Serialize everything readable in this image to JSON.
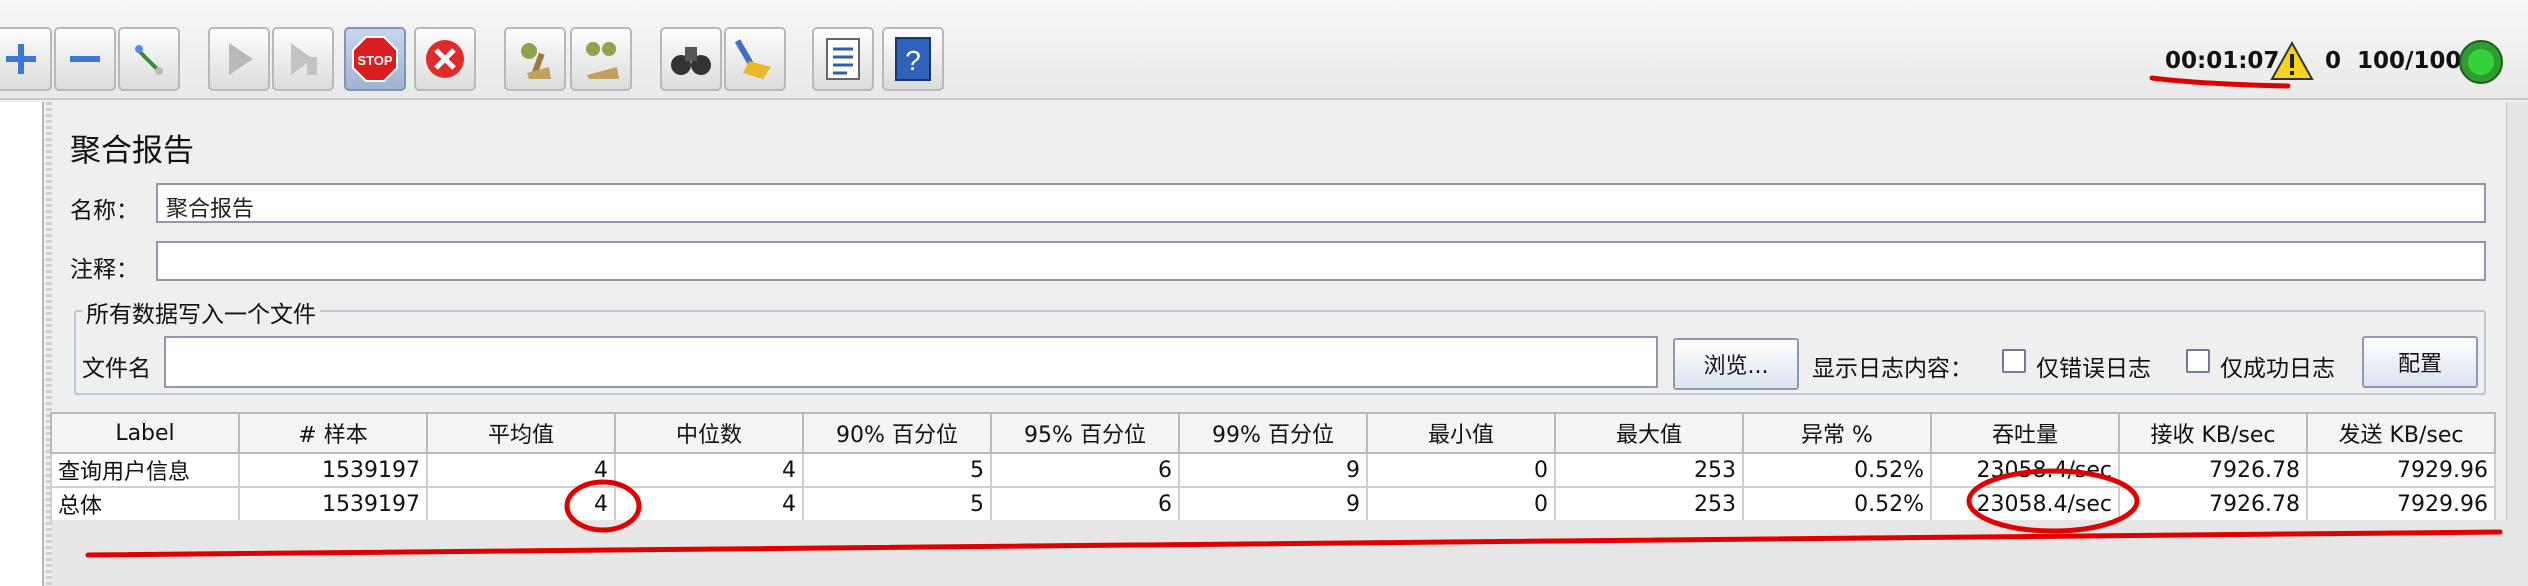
{
  "toolbar": {
    "buttons": [
      "add",
      "remove",
      "toggle",
      "start",
      "start-no-pause",
      "stop",
      "shutdown",
      "clear",
      "clear-all",
      "search",
      "reset-search",
      "function-helper",
      "help"
    ]
  },
  "status": {
    "timer": "00:01:07",
    "error_count": "0",
    "threads": "100/100"
  },
  "panel": {
    "title": "聚合报告",
    "name_label": "名称：",
    "name_value": "聚合报告",
    "comment_label": "注释：",
    "comment_value": "",
    "file_group_title": "所有数据写入一个文件",
    "filename_label": "文件名",
    "filename_value": "",
    "browse_label": "浏览...",
    "log_content_label": "显示日志内容：",
    "errors_only_label": "仅错误日志",
    "success_only_label": "仅成功日志",
    "configure_label": "配置"
  },
  "table": {
    "columns": [
      "Label",
      "# 样本",
      "平均值",
      "中位数",
      "90% 百分位",
      "95% 百分位",
      "99% 百分位",
      "最小值",
      "最大值",
      "异常 %",
      "吞吐量",
      "接收 KB/sec",
      "发送 KB/sec"
    ],
    "rows": [
      [
        "查询用户信息",
        "1539197",
        "4",
        "4",
        "5",
        "6",
        "9",
        "0",
        "253",
        "0.52%",
        "23058.4/sec",
        "7926.78",
        "7929.96"
      ],
      [
        "总体",
        "1539197",
        "4",
        "4",
        "5",
        "6",
        "9",
        "0",
        "253",
        "0.52%",
        "23058.4/sec",
        "7926.78",
        "7929.96"
      ]
    ]
  },
  "colors": {
    "annotation": "#e00000",
    "run_light": "#22b522"
  }
}
